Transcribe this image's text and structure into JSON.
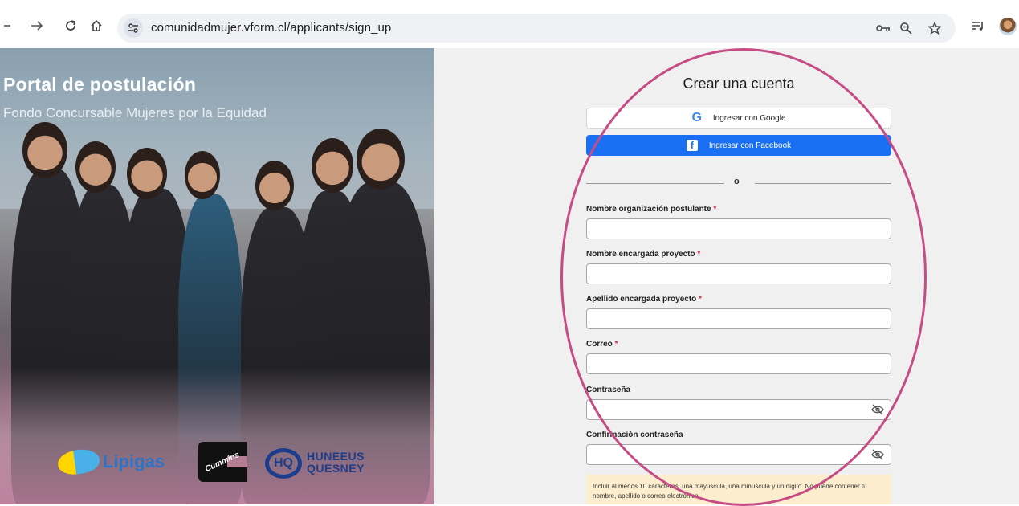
{
  "browser": {
    "url": "comunidadmujer.vform.cl/applicants/sign_up",
    "icons": [
      "back-arrow-icon",
      "forward-arrow-icon",
      "reload-icon",
      "home-icon",
      "site-settings-icon",
      "password-key-icon",
      "zoom-icon",
      "bookmark-star-icon",
      "reading-list-icon",
      "profile-avatar-icon"
    ]
  },
  "hero": {
    "title": "Portal de postulación",
    "subtitle": "Fondo Concursable Mujeres por la Equidad",
    "logos": {
      "lipigas": "Lipigas",
      "cummins": "Cummins",
      "huneeus_line1": "HUNEEUS",
      "huneeus_line2": "QUESNEY"
    }
  },
  "form": {
    "title": "Crear una cuenta",
    "google_label": "Ingresar con Google",
    "facebook_label": "Ingresar con Facebook",
    "divider": "o",
    "required_mark": "*",
    "fields": [
      {
        "label": "Nombre organización postulante",
        "required": true,
        "value": ""
      },
      {
        "label": "Nombre encargada proyecto",
        "required": true,
        "value": ""
      },
      {
        "label": "Apellido encargada proyecto",
        "required": true,
        "value": ""
      },
      {
        "label": "Correo",
        "required": true,
        "value": ""
      },
      {
        "label": "Contraseña",
        "required": false,
        "value": ""
      },
      {
        "label": "Confirmación contraseña",
        "required": false,
        "value": ""
      }
    ],
    "password_hint": "Incluir al menos 10 caracteres, una mayúscula, una minúscula y un dígito. No puede contener tu nombre, apellido o correo electrónico."
  },
  "colors": {
    "facebook_blue": "#1b6ff2",
    "required_red": "#d8203f",
    "annotation_pink": "#c64c86",
    "hint_background": "#fbedce"
  }
}
